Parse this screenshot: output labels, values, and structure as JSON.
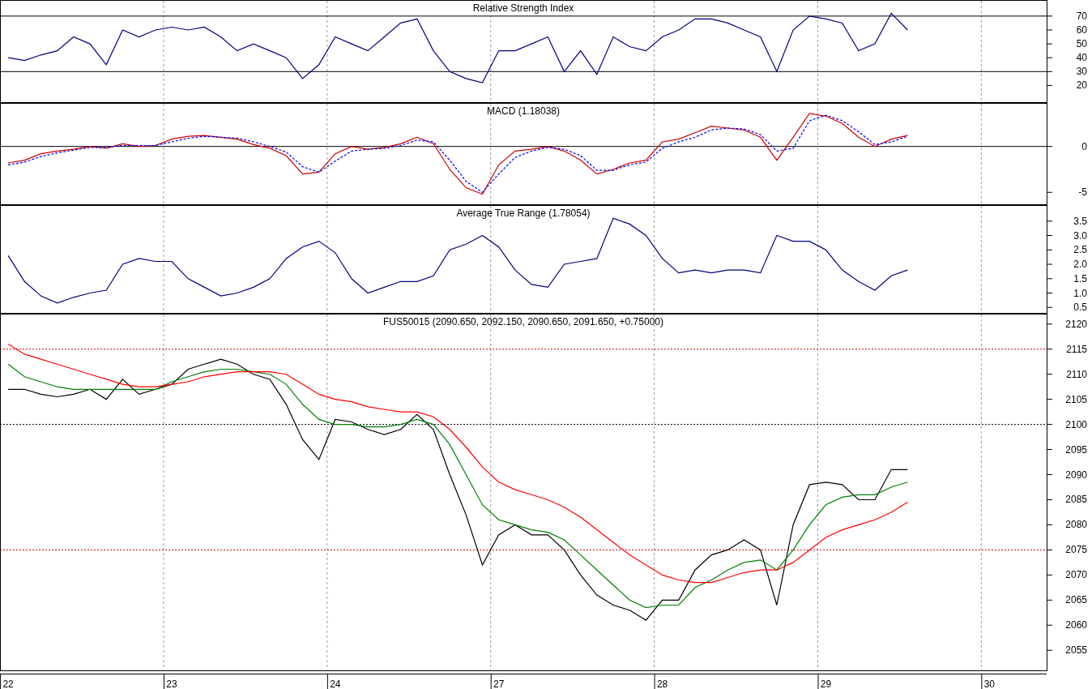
{
  "panels": [
    {
      "chart_data": {
        "type": "line",
        "title": "Relative Strength Index",
        "categories": [
          null,
          null,
          null,
          null,
          null,
          null,
          null,
          null,
          null,
          null,
          null,
          null,
          null,
          null,
          null,
          null,
          null,
          null,
          null,
          null,
          null,
          null,
          null,
          null,
          null,
          null,
          null,
          null,
          null,
          null,
          null,
          null,
          null,
          null,
          null,
          null,
          null,
          null,
          null,
          null,
          null,
          null,
          null,
          null,
          null,
          null,
          null,
          null,
          null,
          null,
          null,
          null,
          null,
          null,
          null,
          null,
          null,
          null,
          null,
          null,
          null,
          null,
          null,
          null
        ],
        "grid": true,
        "ylim": [
          8,
          81
        ],
        "yticks": [
          20,
          30,
          40,
          50,
          60,
          70
        ],
        "series": [
          {
            "color": "#000080",
            "values": [
              40,
              38,
              42,
              45,
              55,
              50,
              35,
              60,
              55,
              60,
              62,
              60,
              62,
              55,
              45,
              50,
              45,
              40,
              25,
              35,
              55,
              50,
              45,
              55,
              65,
              68,
              45,
              30,
              25,
              22,
              45,
              45,
              50,
              55,
              30,
              45,
              28,
              55,
              48,
              45,
              55,
              60,
              68,
              68,
              65,
              60,
              55,
              30,
              60,
              70,
              68,
              65,
              45,
              50,
              72,
              60,
              null,
              null,
              null,
              null,
              null,
              null,
              null,
              null
            ]
          }
        ],
        "ref_lines": [
          {
            "axis": "y",
            "value": 70,
            "color": "#000000"
          },
          {
            "axis": "y",
            "value": 30,
            "color": "#000000"
          }
        ]
      }
    },
    {
      "chart_data": {
        "type": "line",
        "title": "MACD (1.18038)",
        "categories": [
          null,
          null,
          null,
          null,
          null,
          null,
          null,
          null,
          null,
          null,
          null,
          null,
          null,
          null,
          null,
          null,
          null,
          null,
          null,
          null,
          null,
          null,
          null,
          null,
          null,
          null,
          null,
          null,
          null,
          null,
          null,
          null,
          null,
          null,
          null,
          null,
          null,
          null,
          null,
          null,
          null,
          null,
          null,
          null,
          null,
          null,
          null,
          null,
          null,
          null,
          null,
          null,
          null,
          null,
          null,
          null,
          null,
          null,
          null,
          null,
          null,
          null,
          null,
          null
        ],
        "grid": true,
        "ylim": [
          -6.3,
          4.65
        ],
        "yticks": [
          -5,
          0
        ],
        "series": [
          {
            "color": "#cc0000",
            "values": [
              -1.8,
              -1.5,
              -0.8,
              -0.5,
              -0.3,
              0,
              -0.2,
              0.3,
              0,
              0.1,
              0.8,
              1.1,
              1.2,
              1,
              0.8,
              0.2,
              -0.2,
              -1,
              -3,
              -2.8,
              -0.8,
              0,
              -0.3,
              -0.1,
              0.3,
              1,
              0.3,
              -2.5,
              -4.5,
              -5.2,
              -2,
              -0.5,
              -0.3,
              0,
              -0.5,
              -1.5,
              -3,
              -2.5,
              -1.8,
              -1.5,
              0.5,
              0.8,
              1.5,
              2.2,
              2,
              1.8,
              1,
              -1.5,
              1,
              3.6,
              3.3,
              2.5,
              1,
              0,
              0.8,
              1.2,
              null,
              null,
              null,
              null,
              null,
              null,
              null,
              null
            ]
          },
          {
            "color": "#0000ff",
            "line_style": "dashed",
            "values": [
              -2,
              -1.7,
              -1.1,
              -0.7,
              -0.4,
              -0.1,
              -0.1,
              0.1,
              0.1,
              0.1,
              0.5,
              0.9,
              1.1,
              1,
              0.9,
              0.5,
              0,
              -0.6,
              -2.2,
              -2.8,
              -1.6,
              -0.5,
              -0.3,
              -0.2,
              0.1,
              0.7,
              0.5,
              -1.5,
              -3.8,
              -5,
              -3,
              -1.2,
              -0.5,
              -0.1,
              -0.3,
              -1,
              -2.6,
              -2.6,
              -2,
              -1.7,
              -0.2,
              0.5,
              1,
              1.8,
              2,
              1.9,
              1.3,
              -0.5,
              -0.2,
              2.8,
              3.4,
              2.8,
              1.6,
              0.2,
              0.5,
              1.1,
              null,
              null,
              null,
              null,
              null,
              null,
              null,
              null
            ]
          }
        ],
        "ref_lines": [
          {
            "axis": "y",
            "value": 0,
            "color": "#000000"
          }
        ]
      }
    },
    {
      "chart_data": {
        "type": "line",
        "title": "Average True Range (1.78054)",
        "categories": [
          null,
          null,
          null,
          null,
          null,
          null,
          null,
          null,
          null,
          null,
          null,
          null,
          null,
          null,
          null,
          null,
          null,
          null,
          null,
          null,
          null,
          null,
          null,
          null,
          null,
          null,
          null,
          null,
          null,
          null,
          null,
          null,
          null,
          null,
          null,
          null,
          null,
          null,
          null,
          null,
          null,
          null,
          null,
          null,
          null,
          null,
          null,
          null,
          null,
          null,
          null,
          null,
          null,
          null,
          null,
          null,
          null,
          null,
          null,
          null,
          null,
          null,
          null,
          null
        ],
        "grid": true,
        "ylim": [
          0.31,
          4.03
        ],
        "yticks": [
          0.5,
          {
            "value": 1,
            "label": "1.0"
          },
          1.5,
          {
            "value": 2,
            "label": "2.0"
          },
          2.5,
          {
            "value": 3,
            "label": "3.0"
          },
          3.5
        ],
        "series": [
          {
            "color": "#000080",
            "values": [
              2.3,
              1.4,
              0.9,
              0.65,
              0.85,
              1,
              1.1,
              2,
              2.2,
              2.1,
              2.1,
              1.5,
              1.2,
              0.9,
              1,
              1.2,
              1.5,
              2.2,
              2.6,
              2.8,
              2.4,
              1.5,
              1,
              1.2,
              1.4,
              1.4,
              1.6,
              2.5,
              2.7,
              3,
              2.6,
              1.8,
              1.3,
              1.2,
              2,
              2.1,
              2.2,
              3.6,
              3.4,
              3,
              2.2,
              1.7,
              1.8,
              1.7,
              1.8,
              1.8,
              1.7,
              3,
              2.8,
              2.8,
              2.5,
              1.8,
              1.4,
              1.1,
              1.6,
              1.8,
              null,
              null,
              null,
              null,
              null,
              null,
              null,
              null
            ]
          }
        ]
      }
    },
    {
      "chart_data": {
        "type": "line",
        "title": "FUS50015 (2090.650, 2092.150, 2090.650, 2091.650, +0.75000)",
        "categories": [
          "22",
          null,
          null,
          null,
          null,
          null,
          null,
          null,
          null,
          null,
          "23",
          null,
          null,
          null,
          null,
          null,
          null,
          null,
          null,
          null,
          "24",
          null,
          null,
          null,
          null,
          null,
          null,
          null,
          null,
          null,
          "27",
          null,
          null,
          null,
          null,
          null,
          null,
          null,
          null,
          null,
          "28",
          null,
          null,
          null,
          null,
          null,
          null,
          null,
          null,
          null,
          "29",
          null,
          null,
          null,
          null,
          null,
          null,
          null,
          null,
          null,
          "30",
          null,
          null,
          null
        ],
        "grid": true,
        "ylim": [
          2051,
          2121.9
        ],
        "yticks": [
          2055,
          2060,
          2065,
          2070,
          2075,
          2080,
          2085,
          2090,
          2095,
          2100,
          2105,
          2110,
          2115,
          2120
        ],
        "series": [
          {
            "color": "#000000",
            "values": [
              2107,
              2107,
              2106,
              2105.5,
              2106,
              2107,
              2105,
              2109,
              2106,
              2107,
              2108,
              2111,
              2112,
              2113,
              2112,
              2110,
              2109,
              2104,
              2097,
              2093,
              2101,
              2100.5,
              2099,
              2098,
              2099,
              2102,
              2099,
              2090,
              2082,
              2072,
              2078,
              2080,
              2078,
              2078,
              2075,
              2070,
              2066,
              2064,
              2063,
              2061,
              2065,
              2065,
              2071,
              2074,
              2075,
              2077,
              2075,
              2064,
              2080,
              2088,
              2088.5,
              2088,
              2085,
              2085,
              2091,
              2091,
              null,
              null,
              null,
              null,
              null,
              null,
              null,
              null
            ]
          },
          {
            "color": "#008000",
            "values": [
              2112,
              2109.5,
              2108.5,
              2107.5,
              2107,
              2107,
              2107,
              2107,
              2107,
              2107,
              2108.5,
              2109.5,
              2110.5,
              2111,
              2111,
              2110.5,
              2110,
              2108,
              2104,
              2101,
              2100,
              2100,
              2099.5,
              2099.5,
              2100,
              2101,
              2100,
              2096,
              2090,
              2084,
              2081,
              2080,
              2079,
              2078.5,
              2077,
              2074,
              2071,
              2068,
              2065,
              2063.5,
              2064,
              2064,
              2067.5,
              2069,
              2071,
              2072.5,
              2073,
              2071,
              2075,
              2080,
              2084,
              2085.5,
              2086,
              2086,
              2087.5,
              2088.5,
              null,
              null,
              null,
              null,
              null,
              null,
              null,
              null
            ]
          },
          {
            "color": "#ff0000",
            "values": [
              2116,
              2114,
              2113,
              2112,
              2111,
              2110,
              2109,
              2108,
              2107.5,
              2107.5,
              2108,
              2108.5,
              2109.5,
              2110,
              2110.5,
              2110.5,
              2110.5,
              2110,
              2108,
              2106,
              2105,
              2104.5,
              2103.5,
              2103,
              2102.5,
              2102.5,
              2101.5,
              2099,
              2095.5,
              2091.5,
              2088.5,
              2087,
              2086,
              2085,
              2083.5,
              2081.5,
              2079,
              2076.5,
              2074,
              2072,
              2070,
              2069,
              2068.5,
              2068.5,
              2069.5,
              2070.5,
              2071,
              2071,
              2072.5,
              2075,
              2077.5,
              2079,
              2080,
              2081,
              2082.5,
              2084.5,
              null,
              null,
              null,
              null,
              null,
              null,
              null,
              null
            ]
          }
        ],
        "ref_lines": [
          {
            "axis": "y",
            "value": 2115,
            "color": "#cc0000"
          },
          {
            "axis": "y",
            "value": 2100,
            "color": "#000000"
          },
          {
            "axis": "y",
            "value": 2075,
            "color": "#cc0000"
          }
        ]
      }
    }
  ]
}
